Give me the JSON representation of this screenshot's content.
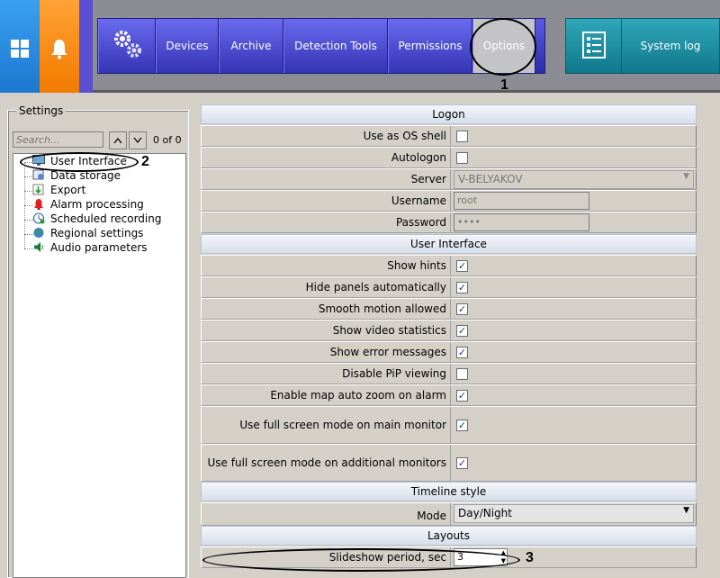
{
  "nav": {
    "devices": "Devices",
    "archive": "Archive",
    "detection_tools": "Detection Tools",
    "permissions": "Permissions",
    "options": "Options",
    "system_log": "System log"
  },
  "callouts": {
    "c1": "1",
    "c2": "2",
    "c3": "3"
  },
  "settings": {
    "legend": "Settings",
    "search_placeholder": "Search...",
    "match_count": "0 of 0",
    "tree": [
      {
        "label": "User Interface",
        "icon": "monitor-icon"
      },
      {
        "label": "Data storage",
        "icon": "database-icon"
      },
      {
        "label": "Export",
        "icon": "export-icon"
      },
      {
        "label": "Alarm processing",
        "icon": "alarm-icon"
      },
      {
        "label": "Scheduled recording",
        "icon": "clock-icon"
      },
      {
        "label": "Regional settings",
        "icon": "globe-icon"
      },
      {
        "label": "Audio parameters",
        "icon": "speaker-icon"
      }
    ]
  },
  "grid": {
    "logon": {
      "title": "Logon",
      "use_os_shell": {
        "label": "Use as OS shell",
        "checked": false
      },
      "autologon": {
        "label": "Autologon",
        "checked": false
      },
      "server": {
        "label": "Server",
        "value": "V-BELYAKOV"
      },
      "username": {
        "label": "Username",
        "value": "root"
      },
      "password": {
        "label": "Password",
        "value": "••••"
      }
    },
    "ui": {
      "title": "User Interface",
      "show_hints": {
        "label": "Show hints",
        "checked": true
      },
      "hide_panels": {
        "label": "Hide panels automatically",
        "checked": true
      },
      "smooth_motion": {
        "label": "Smooth motion allowed",
        "checked": true
      },
      "show_video_stats": {
        "label": "Show video statistics",
        "checked": true
      },
      "show_errors": {
        "label": "Show error messages",
        "checked": true
      },
      "disable_pip": {
        "label": "Disable PiP viewing",
        "checked": false
      },
      "map_auto_zoom": {
        "label": "Enable map auto zoom on alarm",
        "checked": true
      },
      "fullscreen_main": {
        "label": "Use full screen mode on main monitor",
        "checked": true
      },
      "fullscreen_additional": {
        "label": "Use full screen mode on additional monitors",
        "checked": true
      }
    },
    "timeline": {
      "title": "Timeline style",
      "mode": {
        "label": "Mode",
        "value": "Day/Night"
      }
    },
    "layouts": {
      "title": "Layouts",
      "slideshow": {
        "label": "Slideshow period, sec",
        "value": "3"
      }
    }
  },
  "check_glyph": "✓"
}
